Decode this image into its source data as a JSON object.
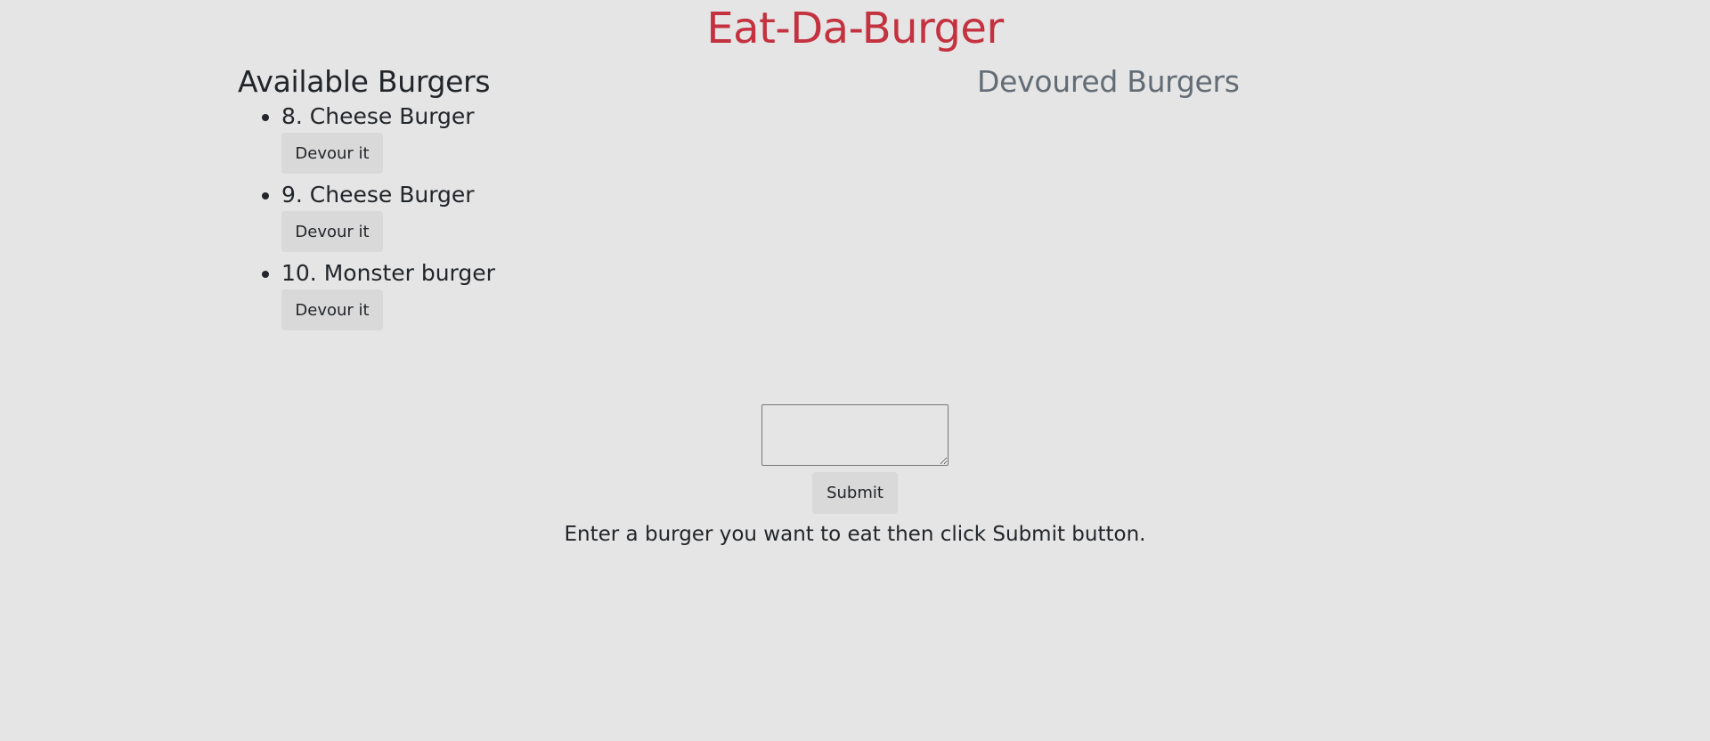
{
  "header": {
    "title": "Eat-Da-Burger"
  },
  "available": {
    "title": "Available Burgers",
    "items": [
      {
        "label": "8. Cheese Burger",
        "button": "Devour it"
      },
      {
        "label": "9. Cheese Burger",
        "button": "Devour it"
      },
      {
        "label": "10. Monster burger",
        "button": "Devour it"
      }
    ]
  },
  "devoured": {
    "title": "Devoured Burgers",
    "items": []
  },
  "form": {
    "input_value": "",
    "submit_label": "Submit",
    "help_text": "Enter a burger you want to eat then click Submit button."
  },
  "colors": {
    "background": "#e5e5e5",
    "title": "#c4313f",
    "devoured_heading": "#636c75",
    "button": "#d9d9d9"
  }
}
